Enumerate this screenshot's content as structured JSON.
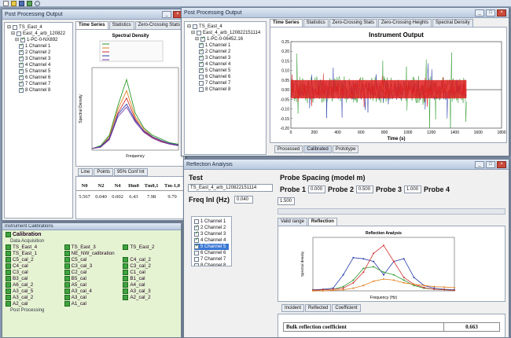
{
  "toolbar": {
    "icons": [
      "new-icon",
      "open-icon",
      "save-icon",
      "run-icon",
      "help-icon"
    ]
  },
  "win1": {
    "title": "Post Processing Output",
    "tree": [
      {
        "label": "TS_East_4",
        "checked": false,
        "depth": 0
      },
      {
        "label": "East_4_arb_120822",
        "checked": false,
        "depth": 1
      },
      {
        "label": "1-PC-0-NX892",
        "checked": true,
        "depth": 2
      },
      {
        "label": "1 Channel 1",
        "checked": true,
        "depth": 3
      },
      {
        "label": "2 Channel 2",
        "checked": true,
        "depth": 3
      },
      {
        "label": "3 Channel 3",
        "checked": true,
        "depth": 3
      },
      {
        "label": "4 Channel 4",
        "checked": true,
        "depth": 3
      },
      {
        "label": "5 Channel 5",
        "checked": true,
        "depth": 3
      },
      {
        "label": "6 Channel 6",
        "checked": true,
        "depth": 3
      },
      {
        "label": "7 Channel 7",
        "checked": true,
        "depth": 3
      },
      {
        "label": "8 Channel 8",
        "checked": true,
        "depth": 3
      }
    ],
    "tabs": [
      "Time Series",
      "Statistics",
      "Zero-Crossing Stats",
      "Zero-Cro"
    ],
    "bottom_tabs": [
      "Line",
      "Points",
      "95% Conf Int"
    ],
    "table_headers": [
      "N0",
      "N2",
      "N4",
      "Hm0",
      "Tm0,1",
      "Tm-1,0"
    ],
    "table_row": [
      "5.567",
      "0.040",
      "0.002",
      "6.43",
      "7.98",
      "9.79"
    ]
  },
  "spectral": {
    "chart_data": {
      "type": "line",
      "title": "Spectral Density",
      "xlabel": "Frequency",
      "ylabel": "Spectral Density",
      "x": [
        0,
        0.1,
        0.2,
        0.3,
        0.4,
        0.5,
        0.6,
        0.7,
        0.8,
        0.9,
        1.0
      ],
      "series": [
        {
          "color": "#2f9a2f",
          "values": [
            0.02,
            0.06,
            0.2,
            0.6,
            0.95,
            0.5,
            0.3,
            0.2,
            0.15,
            0.1,
            0.08
          ]
        },
        {
          "color": "#e08020",
          "values": [
            0.02,
            0.05,
            0.18,
            0.55,
            0.8,
            0.45,
            0.28,
            0.18,
            0.12,
            0.09,
            0.07
          ]
        },
        {
          "color": "#d03030",
          "values": [
            0.02,
            0.04,
            0.15,
            0.5,
            0.7,
            0.42,
            0.25,
            0.17,
            0.12,
            0.08,
            0.06
          ]
        },
        {
          "color": "#2a3ea8",
          "values": [
            0.02,
            0.05,
            0.16,
            0.48,
            0.62,
            0.4,
            0.26,
            0.18,
            0.13,
            0.09,
            0.07
          ]
        },
        {
          "color": "#7b3aa8",
          "values": [
            0.02,
            0.04,
            0.14,
            0.45,
            0.58,
            0.38,
            0.24,
            0.16,
            0.11,
            0.08,
            0.06
          ]
        }
      ]
    }
  },
  "win2": {
    "title": "Post Processing Output",
    "tree": [
      {
        "label": "TS_East_4",
        "checked": false,
        "depth": 0
      },
      {
        "label": "East_4_arb_120822151114",
        "checked": false,
        "depth": 1
      },
      {
        "label": "1-PC-0-06452.16",
        "checked": true,
        "depth": 2
      },
      {
        "label": "1 Channel 1",
        "checked": true,
        "depth": 3
      },
      {
        "label": "2 Channel 2",
        "checked": true,
        "depth": 3
      },
      {
        "label": "3 Channel 3",
        "checked": true,
        "depth": 3
      },
      {
        "label": "4 Channel 4",
        "checked": true,
        "depth": 3
      },
      {
        "label": "5 Channel 5",
        "checked": true,
        "depth": 3
      },
      {
        "label": "6 Channel 6",
        "checked": false,
        "depth": 3
      },
      {
        "label": "7 Channel 7",
        "checked": false,
        "depth": 3
      },
      {
        "label": "8 Channel 8",
        "checked": false,
        "depth": 3
      }
    ],
    "tabs": [
      "Time Series",
      "Statistics",
      "Zero-Crossing Stats",
      "Zero-Crossing Heights",
      "Spectral Density"
    ],
    "bottom_tabs": [
      "Processed",
      "Calibrated",
      "Prototype"
    ]
  },
  "instrument": {
    "chart_data": {
      "type": "line",
      "title": "Instrument Output",
      "xlabel": "Time (s)",
      "ylabel": "",
      "xlim": [
        0,
        1800
      ],
      "ylim": [
        -0.2,
        0.25
      ],
      "x_ticks": [
        "0",
        "200",
        "400",
        "600",
        "800",
        "1000",
        "1200",
        "1400",
        "1600",
        "1800"
      ],
      "y_ticks": [
        "0.25",
        "0.20",
        "0.15",
        "0.10",
        "0.05",
        "0.00",
        "-0.05",
        "-0.10",
        "-0.15",
        "-0.20"
      ],
      "signal_end": 1500,
      "series": [
        {
          "color": "#2f9a2f",
          "amplitude": 0.2
        },
        {
          "color": "#2a3ea8",
          "amplitude": 0.15
        },
        {
          "color": "#e02020",
          "amplitude": 0.09
        }
      ]
    }
  },
  "win3": {
    "title": "Reflection Analysis",
    "test_label": "Test",
    "test_value": "TS_East_4_arb_120822151114",
    "freq_label": "Freq Inl (Hz)",
    "freq_value": "0.040",
    "probe_spacing_label": "Probe Spacing (model m)",
    "probes": [
      {
        "label": "Probe 1",
        "value": "0.000"
      },
      {
        "label": "Probe 2",
        "value": "0.500"
      },
      {
        "label": "Probe 3",
        "value": "1.000"
      },
      {
        "label": "Probe 4",
        "value": "1.500"
      }
    ],
    "channels": [
      {
        "label": "1 Channel 1",
        "checked": false
      },
      {
        "label": "2 Channel 2",
        "checked": true
      },
      {
        "label": "3 Channel 3",
        "checked": true
      },
      {
        "label": "4 Channel 4",
        "checked": true
      },
      {
        "label": "5 Channel 5",
        "checked": true,
        "selected": true
      },
      {
        "label": "6 Channel 6",
        "checked": false
      },
      {
        "label": "7 Channel 7",
        "checked": false
      },
      {
        "label": "8 Channel 8",
        "checked": false
      }
    ],
    "tabs": [
      "Valid range",
      "Reflection"
    ],
    "bottom_tabs": [
      "Incident",
      "Reflected",
      "Coefficient"
    ],
    "result_label": "Bulk reflection coefficient",
    "result_value": "0.663"
  },
  "reflection": {
    "chart_data": {
      "type": "line",
      "title": "Reflection Analysis",
      "xlabel": "Frequency (Hz)",
      "ylabel": "Spectral density",
      "x": [
        0,
        0.05,
        0.1,
        0.15,
        0.2,
        0.25,
        0.3,
        0.35,
        0.4,
        0.45,
        0.5,
        0.55,
        0.6,
        0.65,
        0.7
      ],
      "series": [
        {
          "color": "#2a3ea8",
          "values": [
            0.02,
            0.03,
            0.05,
            0.3,
            0.62,
            0.6,
            0.55,
            0.3,
            0.55,
            0.6,
            0.25,
            0.1,
            0.05,
            0.03,
            0.02
          ]
        },
        {
          "color": "#2f9a2f",
          "values": [
            0.01,
            0.02,
            0.03,
            0.08,
            0.2,
            0.42,
            0.45,
            0.35,
            0.3,
            0.2,
            0.1,
            0.05,
            0.03,
            0.02,
            0.01
          ]
        },
        {
          "color": "#d03030",
          "values": [
            0.01,
            0.02,
            0.03,
            0.05,
            0.15,
            0.35,
            0.7,
            0.85,
            0.55,
            0.25,
            0.12,
            0.06,
            0.03,
            0.02,
            0.01
          ]
        },
        {
          "color": "#e08020",
          "values": [
            0.0,
            0.0,
            0.01,
            0.02,
            0.05,
            0.1,
            0.18,
            0.22,
            0.2,
            0.15,
            0.12,
            0.1,
            0.08,
            0.07,
            0.06
          ]
        }
      ]
    }
  },
  "catalog": {
    "title": "Instrument Calibrations",
    "calibration_label": "Calibration",
    "section_label": "Data Acquisition",
    "items": [
      "TS_East_4",
      "TS_East_3",
      "TS_East_2",
      "TS_East_1",
      "NE_NW_calibration",
      "",
      "C5_cal_2",
      "C5_cal",
      "C4_cal_2",
      "C4_cal",
      "C3_cal_3",
      "C3_cal_2",
      "C3_cal",
      "C2_cal",
      "C1_cal",
      "B3_cal",
      "B5_cal",
      "B1_cal",
      "A6_cal_2",
      "A5_cal",
      "A4_cal",
      "A3_cal_5",
      "A3_cal_4",
      "A3_cal_3",
      "A3_cal_2",
      "A3_cal",
      "A2_cal_2",
      "A2_cal",
      "A1_cal",
      ""
    ],
    "footer_label": "Post Processing"
  }
}
